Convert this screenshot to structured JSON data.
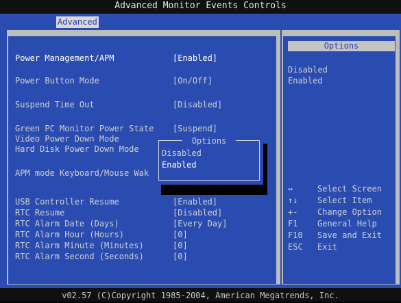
{
  "title": "Advanced Monitor Events Controls",
  "menu": {
    "active_tab": "Advanced"
  },
  "settings": [
    {
      "label": "Power Management/APM",
      "value": "[Enabled]"
    },
    {
      "label": "Power Button Mode",
      "value": "[On/Off]"
    },
    {
      "label": "Suspend Time Out",
      "value": "[Disabled]"
    },
    {
      "label": "Green PC Monitor Power State",
      "value": "[Suspend]"
    },
    {
      "label": "Video Power Down Mode",
      "value": ""
    },
    {
      "label": "Hard Disk Power Down Mode",
      "value": ""
    },
    {
      "label": "APM mode Keyboard/Mouse Wak",
      "value": ""
    },
    {
      "label": "USB Controller Resume",
      "value": "[Enabled]"
    },
    {
      "label": "RTC Resume",
      "value": "[Disabled]"
    },
    {
      "label": "RTC Alarm Date (Days)",
      "value": "[Every Day]"
    },
    {
      "label": "RTC Alarm Hour (Hours)",
      "value": "[0]"
    },
    {
      "label": "RTC Alarm Minute (Minutes)",
      "value": "[0]"
    },
    {
      "label": "RTC Alarm Second (Seconds)",
      "value": "[0]"
    }
  ],
  "options_panel": {
    "title": "Options",
    "items": [
      "Disabled",
      "Enabled"
    ]
  },
  "popup": {
    "title": "Options",
    "options": [
      "Disabled",
      "Enabled"
    ],
    "selected": "Enabled"
  },
  "help": [
    {
      "key": "↔",
      "action": "Select Screen"
    },
    {
      "key": "↑↓",
      "action": "Select Item"
    },
    {
      "key": "+-",
      "action": "Change Option"
    },
    {
      "key": "F1",
      "action": "General Help"
    },
    {
      "key": "F10",
      "action": "Save and Exit"
    },
    {
      "key": "ESC",
      "action": "Exit"
    }
  ],
  "footer": "v02.57 (C)Copyright 1985-2004, American Megatrends, Inc.",
  "colors": {
    "background": "#2a4cb0",
    "frame": "#bdbdbd",
    "text": "#d0d0d0",
    "highlight_text": "#ffffff",
    "title_bar": "#101010"
  }
}
